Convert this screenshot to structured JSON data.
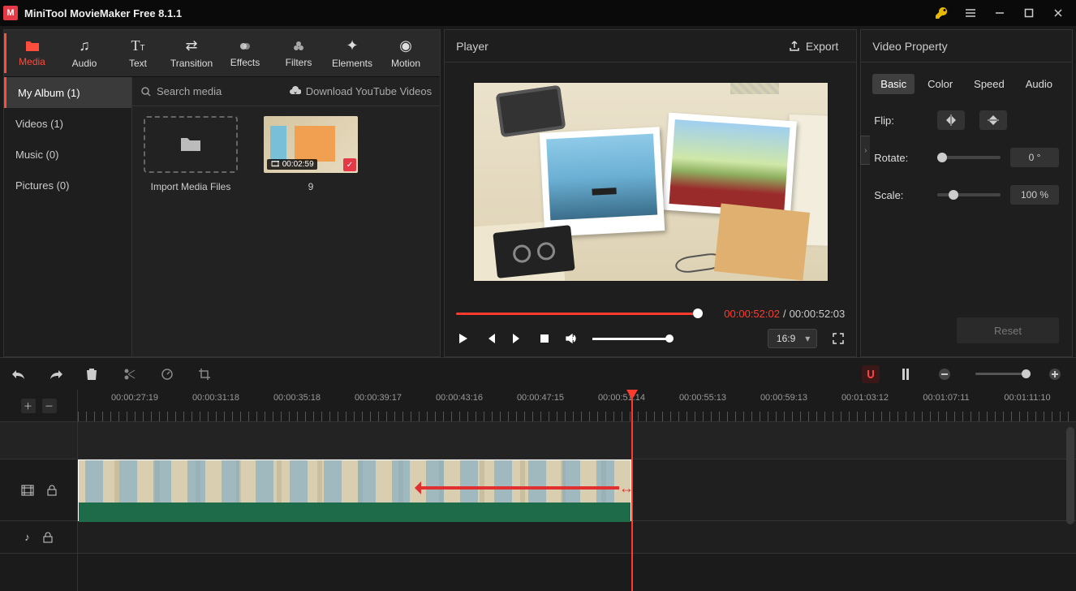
{
  "app": {
    "title": "MiniTool MovieMaker Free 8.1.1"
  },
  "toolTabs": [
    {
      "key": "media",
      "label": "Media"
    },
    {
      "key": "audio",
      "label": "Audio"
    },
    {
      "key": "text",
      "label": "Text"
    },
    {
      "key": "transition",
      "label": "Transition"
    },
    {
      "key": "effects",
      "label": "Effects"
    },
    {
      "key": "filters",
      "label": "Filters"
    },
    {
      "key": "elements",
      "label": "Elements"
    },
    {
      "key": "motion",
      "label": "Motion"
    }
  ],
  "sidebar": {
    "items": [
      {
        "label": "My Album (1)"
      },
      {
        "label": "Videos (1)"
      },
      {
        "label": "Music (0)"
      },
      {
        "label": "Pictures (0)"
      }
    ]
  },
  "mediaTop": {
    "searchPlaceholder": "Search media",
    "download": "Download YouTube Videos"
  },
  "importBox": {
    "label": "Import Media Files"
  },
  "mediaItem": {
    "duration": "00:02:59",
    "label": "9"
  },
  "player": {
    "title": "Player",
    "export": "Export",
    "currentTime": "00:00:52:02",
    "totalTime": "00:00:52:03",
    "aspect": "16:9"
  },
  "props": {
    "title": "Video Property",
    "tabs": [
      "Basic",
      "Color",
      "Speed",
      "Audio"
    ],
    "flipLabel": "Flip:",
    "rotateLabel": "Rotate:",
    "rotateValue": "0 °",
    "rotateSliderPct": 0,
    "scaleLabel": "Scale:",
    "scaleValue": "100 %",
    "scaleSliderPct": 18,
    "reset": "Reset"
  },
  "ruler": {
    "labels": [
      "00:00:27:19",
      "00:00:31:18",
      "00:00:35:18",
      "00:00:39:17",
      "00:00:43:16",
      "00:00:47:15",
      "00:00:51:14",
      "00:00:55:13",
      "00:00:59:13",
      "00:01:03:12",
      "00:01:07:11",
      "00:01:11:10"
    ],
    "spacingPx": 100,
    "startPx": 70
  }
}
